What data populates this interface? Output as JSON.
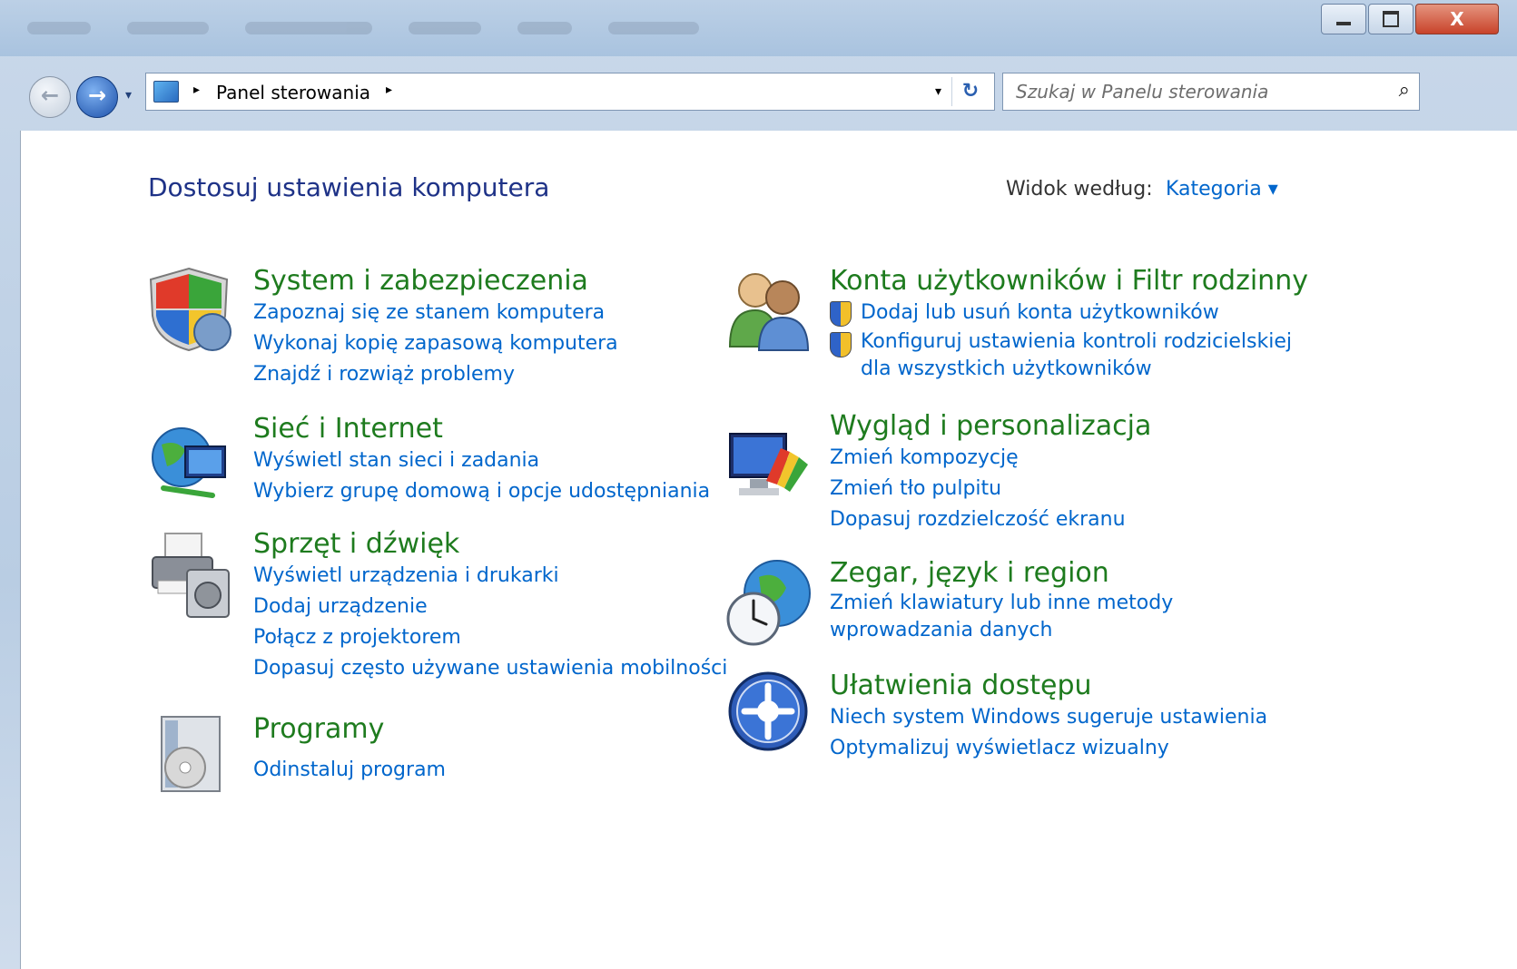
{
  "window": {
    "min_label": "",
    "max_label": "",
    "close_label": "X"
  },
  "nav": {
    "back_glyph": "←",
    "forward_glyph": "→",
    "history_glyph": "▾",
    "breadcrumb_sep1": "▸",
    "breadcrumb_item": "Panel sterowania",
    "breadcrumb_sep2": "▸",
    "addr_dropdown": "▾",
    "refresh_glyph": "↻"
  },
  "search": {
    "placeholder": "Szukaj w Panelu sterowania",
    "icon": "search-icon"
  },
  "page": {
    "title": "Dostosuj ustawienia komputera",
    "view_by_label": "Widok według:",
    "view_by_value": "Kategoria ▾"
  },
  "categories_left": [
    {
      "title": "System i zabezpieczenia",
      "icon": "shield-icon",
      "links": [
        "Zapoznaj się ze stanem komputera",
        "Wykonaj kopię zapasową komputera",
        "Znajdź i rozwiąż problemy"
      ]
    },
    {
      "title": "Sieć i Internet",
      "icon": "network-globe-icon",
      "links": [
        "Wyświetl stan sieci i zadania",
        "Wybierz grupę domową i opcje udostępniania"
      ]
    },
    {
      "title": "Sprzęt i dźwięk",
      "icon": "printer-speaker-icon",
      "links": [
        "Wyświetl urządzenia i drukarki",
        "Dodaj urządzenie",
        "Połącz z projektorem",
        "Dopasuj często używane ustawienia mobilności"
      ]
    },
    {
      "title": "Programy",
      "icon": "programs-box-icon",
      "links": [
        "Odinstaluj program"
      ]
    }
  ],
  "categories_right": [
    {
      "title": "Konta użytkowników i Filtr rodzinny",
      "icon": "users-icon",
      "links": [
        "Dodaj lub usuń konta użytkowników",
        "Konfiguruj ustawienia kontroli rodzicielskiej dla wszystkich użytkowników"
      ]
    },
    {
      "title": "Wygląd i personalizacja",
      "icon": "monitor-palette-icon",
      "links": [
        "Zmień kompozycję",
        "Zmień tło pulpitu",
        "Dopasuj rozdzielczość ekranu"
      ]
    },
    {
      "title": "Zegar, język i region",
      "icon": "clock-globe-icon",
      "links": [
        "Zmień klawiatury lub inne metody wprowadzania danych"
      ]
    },
    {
      "title": "Ułatwienia dostępu",
      "icon": "accessibility-icon",
      "links": [
        "Niech system Windows sugeruje ustawienia",
        "Optymalizuj wyświetlacz wizualny"
      ]
    }
  ]
}
